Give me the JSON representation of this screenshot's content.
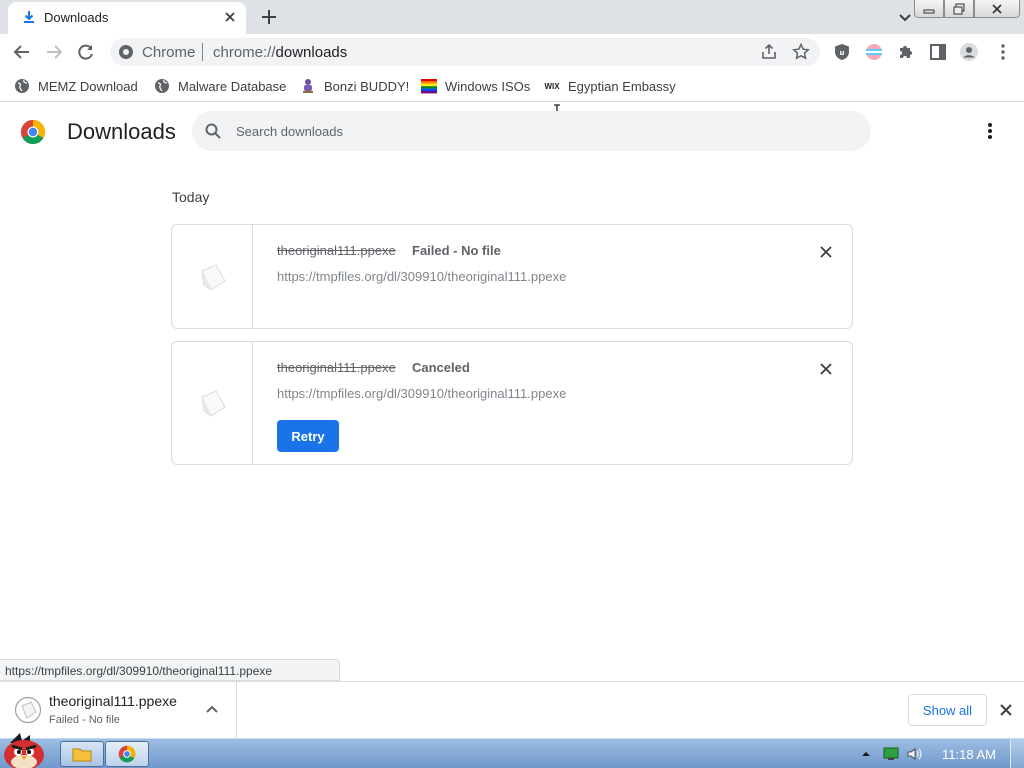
{
  "tab": {
    "title": "Downloads"
  },
  "omnibox": {
    "chip": "Chrome",
    "url_scheme": "chrome://",
    "url_host": "downloads"
  },
  "bookmarks": [
    {
      "label": "MEMZ Download",
      "icon": "globe-icon"
    },
    {
      "label": "Malware Database",
      "icon": "globe-icon"
    },
    {
      "label": "Bonzi BUDDY!",
      "icon": "bonzi-icon"
    },
    {
      "label": "Windows ISOs",
      "icon": "rainbow-icon"
    },
    {
      "label": "Egyptian Embassy",
      "icon": "wix-icon",
      "icon_text": "WIX"
    }
  ],
  "page": {
    "title": "Downloads",
    "search_placeholder": "Search downloads",
    "section": "Today"
  },
  "downloads": [
    {
      "name": "theoriginal111.ppexe",
      "status": "Failed - No file",
      "url": "https://tmpfiles.org/dl/309910/theoriginal111.ppexe"
    },
    {
      "name": "theoriginal111.ppexe",
      "status": "Canceled",
      "url": "https://tmpfiles.org/dl/309910/theoriginal111.ppexe",
      "retry_label": "Retry"
    }
  ],
  "status_bubble": "https://tmpfiles.org/dl/309910/theoriginal111.ppexe",
  "shelf": {
    "name": "theoriginal111.ppexe",
    "status": "Failed - No file",
    "show_all_label": "Show all"
  },
  "taskbar": {
    "clock": "11:18 AM"
  },
  "colors": {
    "accent": "#1a73e8",
    "tab_strip": "#dee1e6",
    "omnibox": "#f1f3f4"
  }
}
